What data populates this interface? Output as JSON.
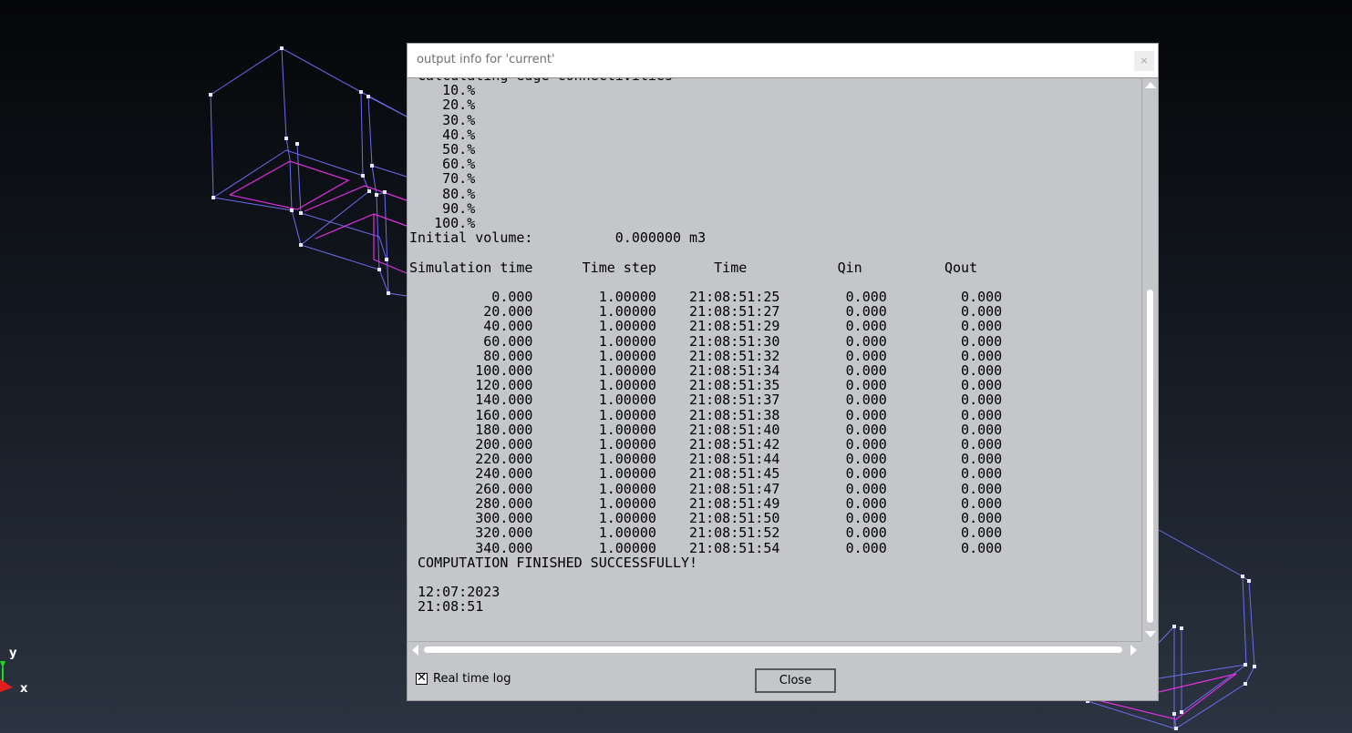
{
  "viewport": {
    "axis_y_label": "y",
    "axis_x_label": "x"
  },
  "dialog": {
    "title": "output info for 'current'",
    "close_icon_glyph": "×",
    "realtime_checkbox_checked": true,
    "realtime_label": "Real time log",
    "close_button_label": "Close"
  },
  "log": {
    "lines": [
      " Calculating edge connectivities",
      "    10.%",
      "    20.%",
      "    30.%",
      "    40.%",
      "    50.%",
      "    60.%",
      "    70.%",
      "    80.%",
      "    90.%",
      "   100.%",
      "Initial volume:          0.000000 m3",
      "",
      "Simulation time      Time step       Time           Qin          Qout",
      "",
      "          0.000        1.00000    21:08:51:25        0.000         0.000",
      "         20.000        1.00000    21:08:51:27        0.000         0.000",
      "         40.000        1.00000    21:08:51:29        0.000         0.000",
      "         60.000        1.00000    21:08:51:30        0.000         0.000",
      "         80.000        1.00000    21:08:51:32        0.000         0.000",
      "        100.000        1.00000    21:08:51:34        0.000         0.000",
      "        120.000        1.00000    21:08:51:35        0.000         0.000",
      "        140.000        1.00000    21:08:51:37        0.000         0.000",
      "        160.000        1.00000    21:08:51:38        0.000         0.000",
      "        180.000        1.00000    21:08:51:40        0.000         0.000",
      "        200.000        1.00000    21:08:51:42        0.000         0.000",
      "        220.000        1.00000    21:08:51:44        0.000         0.000",
      "        240.000        1.00000    21:08:51:45        0.000         0.000",
      "        260.000        1.00000    21:08:51:47        0.000         0.000",
      "        280.000        1.00000    21:08:51:49        0.000         0.000",
      "        300.000        1.00000    21:08:51:50        0.000         0.000",
      "        320.000        1.00000    21:08:51:52        0.000         0.000",
      "        340.000        1.00000    21:08:51:54        0.000         0.000",
      " COMPUTATION FINISHED SUCCESSFULLY!",
      "",
      " 12:07:2023",
      " 21:08:51"
    ]
  },
  "colors": {
    "wireframe_blue": "#6b6cf0",
    "wireframe_magenta": "#e030e0",
    "node_white": "#e6e6ff",
    "dialog_bg": "#c4c6c9",
    "axis_y_green": "#18e018",
    "axis_x_red": "#e02020"
  }
}
